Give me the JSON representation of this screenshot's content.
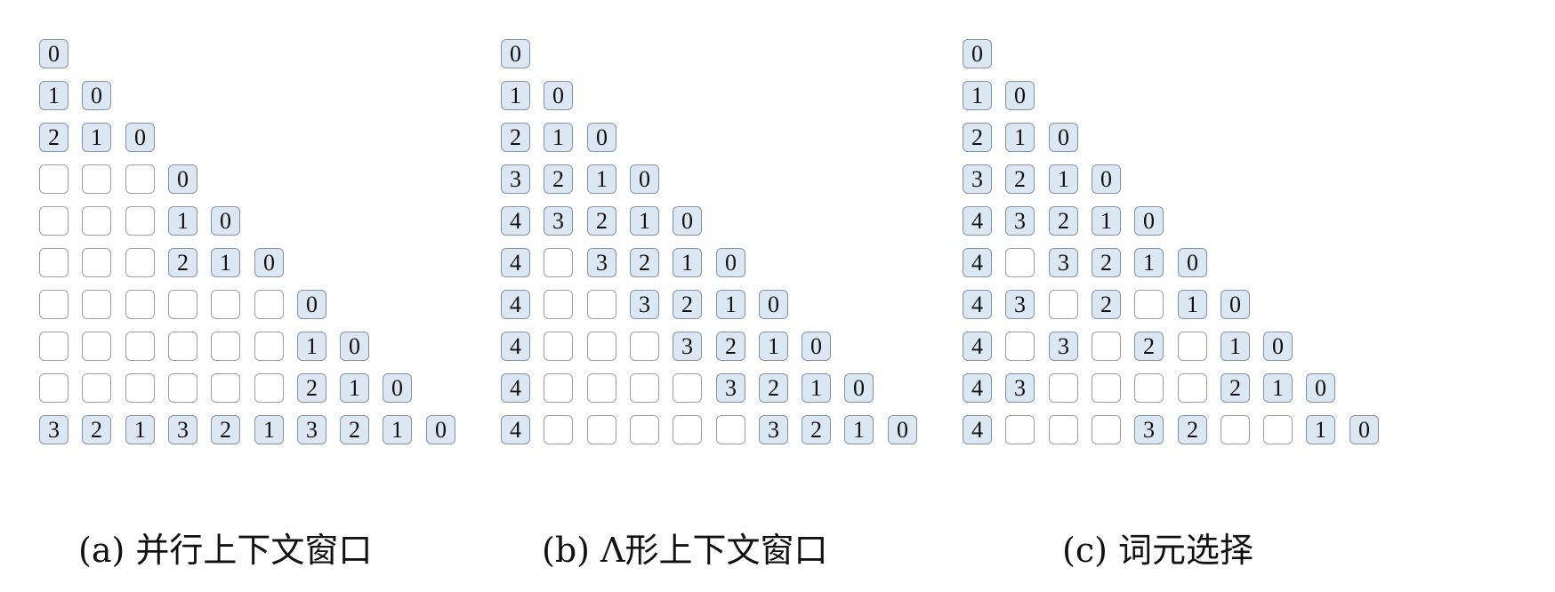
{
  "panels": [
    {
      "caption": "(a) 并行上下文窗口",
      "rows": [
        [
          "0"
        ],
        [
          "1",
          "0"
        ],
        [
          "2",
          "1",
          "0"
        ],
        [
          "",
          "",
          "",
          "0"
        ],
        [
          "",
          "",
          "",
          "1",
          "0"
        ],
        [
          "",
          "",
          "",
          "2",
          "1",
          "0"
        ],
        [
          "",
          "",
          "",
          "",
          "",
          "",
          "0"
        ],
        [
          "",
          "",
          "",
          "",
          "",
          "",
          "1",
          "0"
        ],
        [
          "",
          "",
          "",
          "",
          "",
          "",
          "2",
          "1",
          "0"
        ],
        [
          "3",
          "2",
          "1",
          "3",
          "2",
          "1",
          "3",
          "2",
          "1",
          "0"
        ]
      ]
    },
    {
      "caption": "(b) Λ形上下文窗口",
      "rows": [
        [
          "0"
        ],
        [
          "1",
          "0"
        ],
        [
          "2",
          "1",
          "0"
        ],
        [
          "3",
          "2",
          "1",
          "0"
        ],
        [
          "4",
          "3",
          "2",
          "1",
          "0"
        ],
        [
          "4",
          "",
          "3",
          "2",
          "1",
          "0"
        ],
        [
          "4",
          "",
          "",
          "3",
          "2",
          "1",
          "0"
        ],
        [
          "4",
          "",
          "",
          "",
          "3",
          "2",
          "1",
          "0"
        ],
        [
          "4",
          "",
          "",
          "",
          "",
          "3",
          "2",
          "1",
          "0"
        ],
        [
          "4",
          "",
          "",
          "",
          "",
          "",
          "3",
          "2",
          "1",
          "0"
        ]
      ]
    },
    {
      "caption": "(c) 词元选择",
      "rows": [
        [
          "0"
        ],
        [
          "1",
          "0"
        ],
        [
          "2",
          "1",
          "0"
        ],
        [
          "3",
          "2",
          "1",
          "0"
        ],
        [
          "4",
          "3",
          "2",
          "1",
          "0"
        ],
        [
          "4",
          "",
          "3",
          "2",
          "1",
          "0"
        ],
        [
          "4",
          "3",
          "",
          "2",
          "",
          "1",
          "0"
        ],
        [
          "4",
          "",
          "3",
          "",
          "2",
          "",
          "1",
          "0"
        ],
        [
          "4",
          "3",
          "",
          "",
          "",
          "",
          "2",
          "1",
          "0"
        ],
        [
          "4",
          "",
          "",
          "",
          "3",
          "2",
          "",
          "",
          "1",
          "0"
        ]
      ]
    }
  ]
}
